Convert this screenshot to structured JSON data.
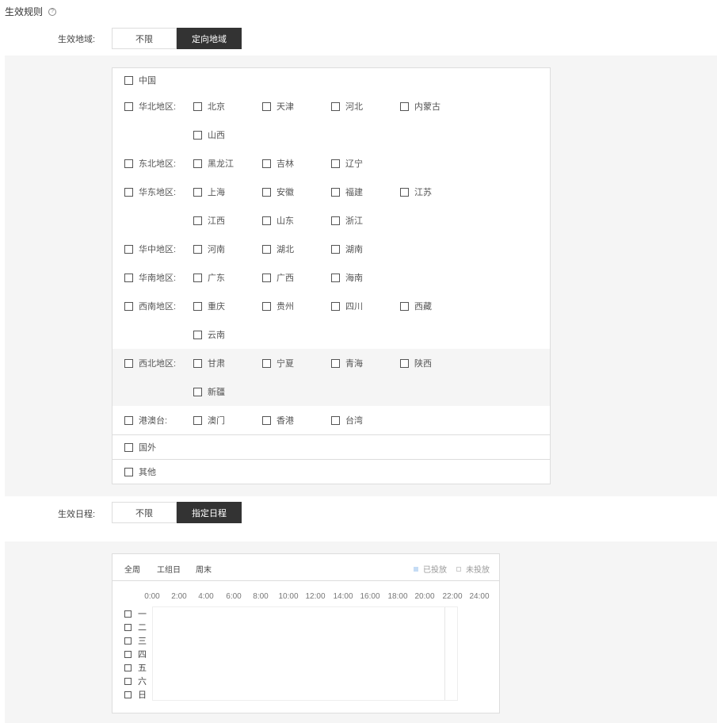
{
  "section": {
    "title": "生效规则",
    "help_icon": "question-circle-icon"
  },
  "region_field": {
    "label": "生效地域:",
    "options": [
      "不限",
      "定向地域"
    ],
    "selected": "定向地域"
  },
  "regions": {
    "china": "中国",
    "groups": [
      {
        "name": "华北地区:",
        "items": [
          "北京",
          "天津",
          "河北",
          "内蒙古",
          "山西"
        ]
      },
      {
        "name": "东北地区:",
        "items": [
          "黑龙江",
          "吉林",
          "辽宁"
        ]
      },
      {
        "name": "华东地区:",
        "items": [
          "上海",
          "安徽",
          "福建",
          "江苏",
          "江西",
          "山东",
          "浙江"
        ]
      },
      {
        "name": "华中地区:",
        "items": [
          "河南",
          "湖北",
          "湖南"
        ]
      },
      {
        "name": "华南地区:",
        "items": [
          "广东",
          "广西",
          "海南"
        ]
      },
      {
        "name": "西南地区:",
        "items": [
          "重庆",
          "贵州",
          "四川",
          "西藏",
          "云南"
        ]
      },
      {
        "name": "西北地区:",
        "items": [
          "甘肃",
          "宁夏",
          "青海",
          "陕西",
          "新疆"
        ]
      },
      {
        "name": "港澳台:",
        "items": [
          "澳门",
          "香港",
          "台湾"
        ]
      }
    ],
    "abroad": "国外",
    "other": "其他"
  },
  "schedule_field": {
    "label": "生效日程:",
    "options": [
      "不限",
      "指定日程"
    ],
    "selected": "指定日程"
  },
  "schedule": {
    "quick": [
      "全周",
      "工组日",
      "周末"
    ],
    "legend": {
      "on": "已投放",
      "off": "未投放",
      "on_color": "#c5dcf5",
      "off_color": "#ffffff"
    },
    "hours": [
      "0:00",
      "2:00",
      "4:00",
      "6:00",
      "8:00",
      "10:00",
      "12:00",
      "14:00",
      "16:00",
      "18:00",
      "20:00",
      "22:00",
      "24:00"
    ],
    "days": [
      "一",
      "二",
      "三",
      "四",
      "五",
      "六",
      "日"
    ]
  }
}
